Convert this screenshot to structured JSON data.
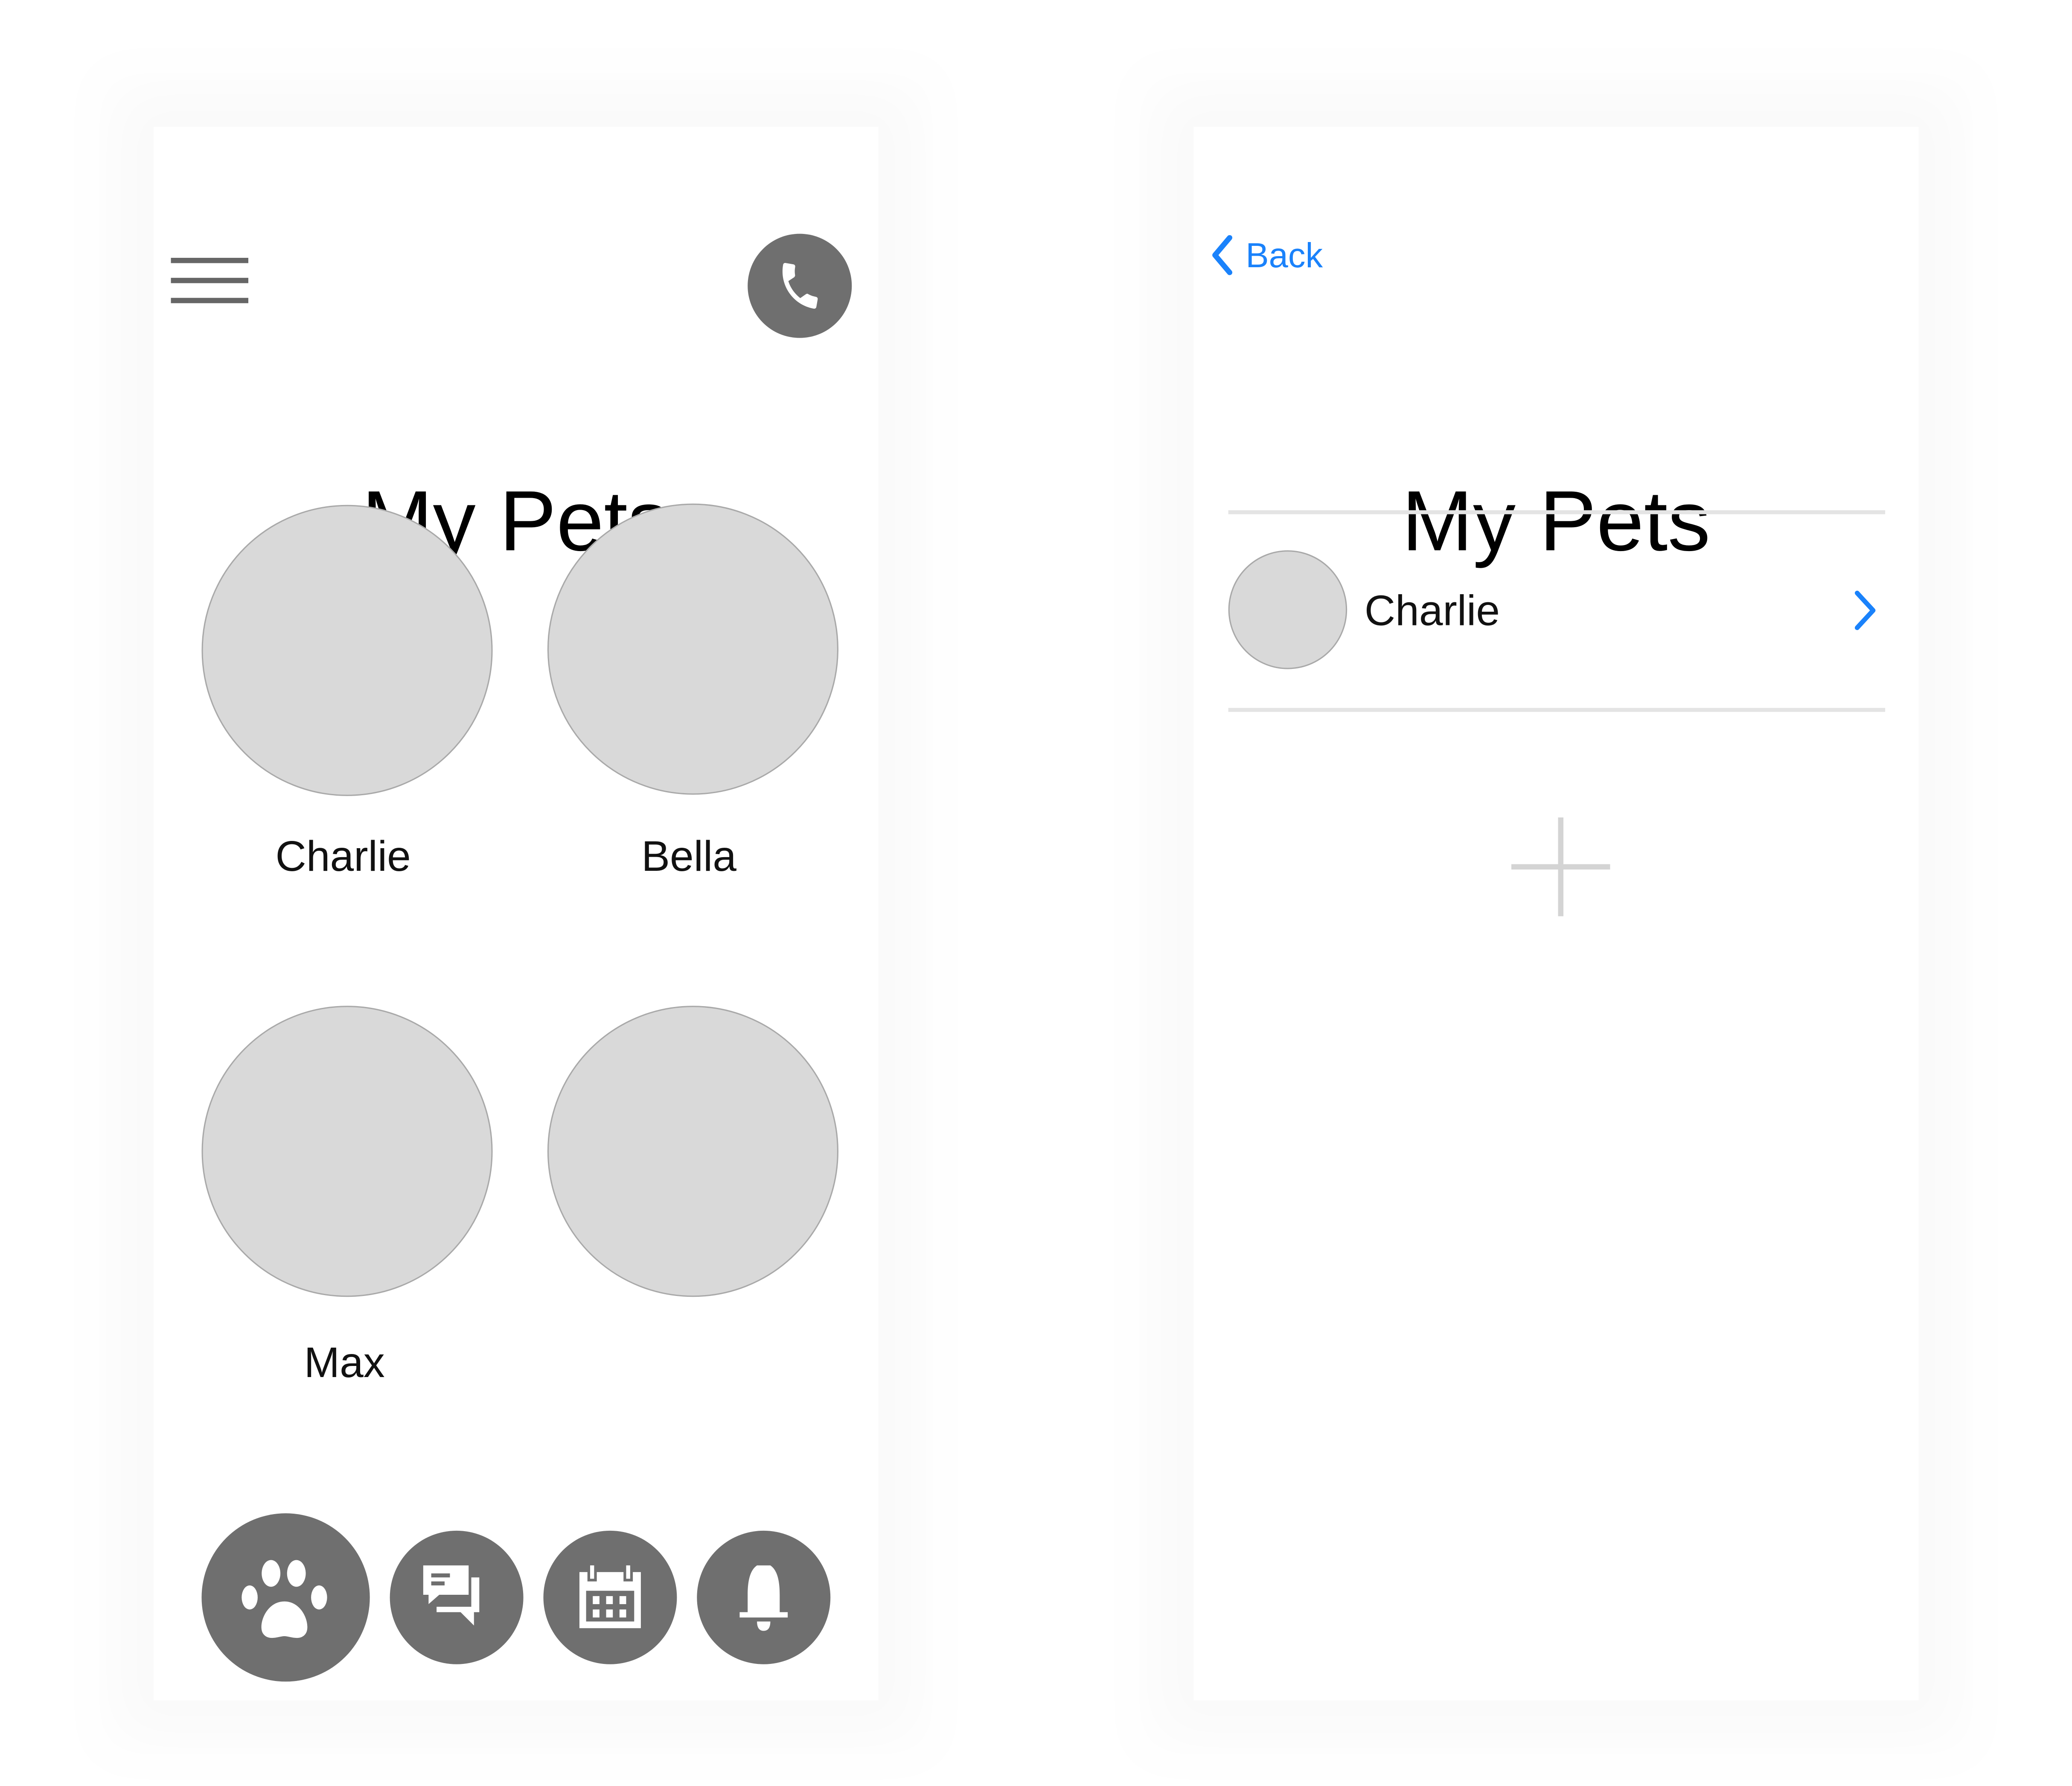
{
  "left_screen": {
    "title": "My Pets",
    "pets": [
      {
        "name": "Charlie"
      },
      {
        "name": "Bella"
      },
      {
        "name": "Max"
      },
      {
        "name": ""
      }
    ],
    "bottom_nav": [
      {
        "icon": "paw-icon"
      },
      {
        "icon": "chat-icon"
      },
      {
        "icon": "calendar-icon"
      },
      {
        "icon": "bell-icon"
      }
    ],
    "icon_color": "#6f6f6f"
  },
  "right_screen": {
    "back_label": "Back",
    "title": "My Pets",
    "list": [
      {
        "name": "Charlie"
      }
    ],
    "accent_color": "#1a82fb"
  }
}
